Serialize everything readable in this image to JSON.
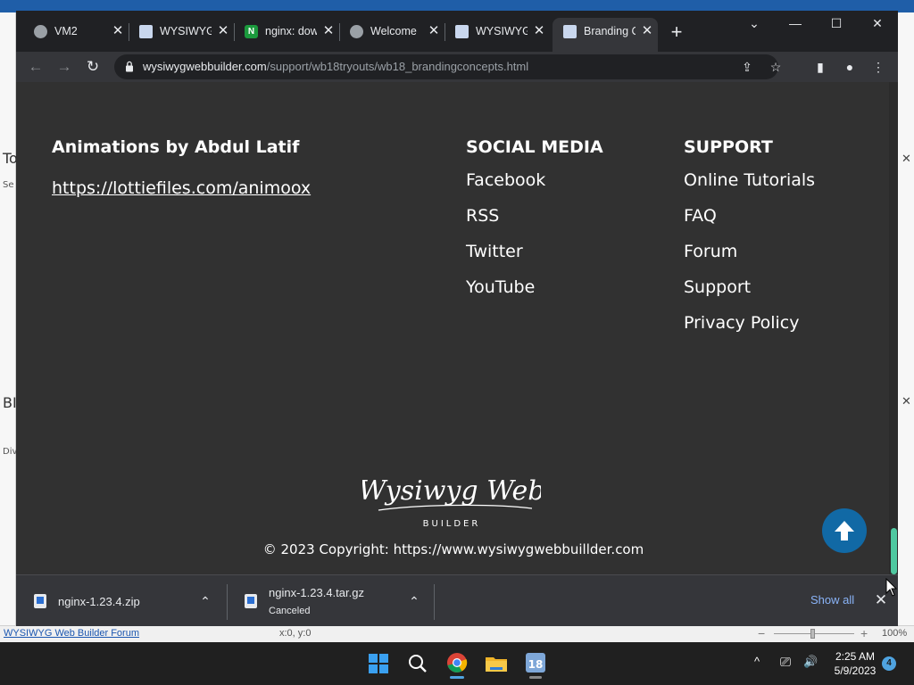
{
  "background_app": {
    "status_link": "WYSIWYG Web Builder Forum",
    "coords": "x:0, y:0",
    "zoom": "100%",
    "left_panel_glyphs": [
      "To",
      "Se",
      "BI",
      "Div"
    ],
    "colors": {
      "title_bar": "#1f5ea8"
    }
  },
  "browser": {
    "tabs": [
      {
        "label": "VM2",
        "icon": "globe-icon",
        "close": "✕"
      },
      {
        "label": "WYSIWYG",
        "icon": "wysiwyg-favicon-icon",
        "close": "✕"
      },
      {
        "label": "nginx: dow",
        "icon": "nginx-favicon-icon",
        "close": "✕"
      },
      {
        "label": "Welcome",
        "icon": "globe-icon",
        "close": "✕"
      },
      {
        "label": "WYSIWYG",
        "icon": "wysiwyg-favicon-icon",
        "close": "✕"
      },
      {
        "label": "Branding C",
        "icon": "wysiwyg-favicon-icon",
        "close": "✕",
        "active": true
      }
    ],
    "new_tab": "+",
    "window_controls": {
      "tab_search": "⌄",
      "minimize": "—",
      "maximize": "☐",
      "close": "✕"
    },
    "nav": {
      "back": "←",
      "forward": "→",
      "reload": "↻"
    },
    "url_host": "wysiwygwebbuilder.com",
    "url_path": "/support/wb18tryouts/wb18_brandingconcepts.html",
    "omnibox_icons": {
      "share": "⇪",
      "bookmark": "☆"
    },
    "toolbar_icons": {
      "side_panel": "▮",
      "profile": "●",
      "menu": "⋮"
    }
  },
  "page": {
    "credits": {
      "title": "Animations by Abdul Latif",
      "link": "https://lottiefiles.com/animoox"
    },
    "social": {
      "title": "SOCIAL MEDIA",
      "links": [
        "Facebook",
        "RSS",
        "Twitter",
        "YouTube"
      ]
    },
    "support": {
      "title": "SUPPORT",
      "links": [
        "Online Tutorials",
        "FAQ",
        "Forum",
        "Support",
        "Privacy Policy"
      ]
    },
    "logo": {
      "script": "Wysiwyg Web",
      "sub": "BUILDER"
    },
    "copyright": "© 2023 Copyright: https://www.wysiwygwebbuillder.com",
    "scroll_top_icon": "arrow-up-icon",
    "colors": {
      "background": "#313131",
      "scroll_top_button": "#1169a5",
      "scrollbar_thumb": "#4fc8a0"
    }
  },
  "downloads": {
    "items": [
      {
        "name": "nginx-1.23.4.zip",
        "status": ""
      },
      {
        "name": "nginx-1.23.4.tar.gz",
        "status": "Canceled"
      }
    ],
    "show_all": "Show all",
    "close": "✕"
  },
  "taskbar": {
    "apps": [
      "windows-start-icon",
      "search-icon",
      "chrome-icon",
      "file-explorer-icon",
      "wysiwyg-builder-icon"
    ],
    "tray": {
      "chevron": "^",
      "network": "⎚",
      "volume": "🔊"
    },
    "time": "2:25 AM",
    "date": "5/9/2023",
    "notifications": "4"
  }
}
